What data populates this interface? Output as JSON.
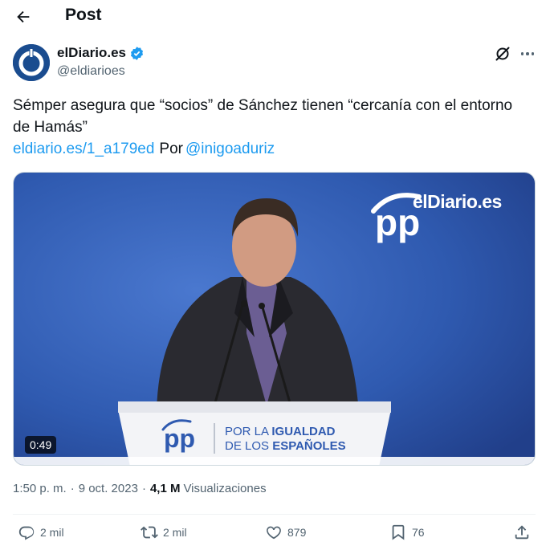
{
  "header": {
    "title": "Post"
  },
  "author": {
    "name": "elDiario.es",
    "handle": "@eldiarioes",
    "verified": true
  },
  "tweet": {
    "text": "Sémper asegura que “socios” de Sánchez tienen “cercanía con el entorno de Hamás”",
    "link": "eldiario.es/1_a179ed",
    "by_label": "Por",
    "mention": "@inigoaduriz"
  },
  "media": {
    "watermark": "elDiario.es",
    "duration": "0:49",
    "podium_line1_a": "POR LA ",
    "podium_line1_b": "IGUALDAD",
    "podium_line2_a": "DE LOS ",
    "podium_line2_b": "ESPAÑOLES",
    "party_logo": "pp"
  },
  "meta": {
    "time": "1:50 p. m.",
    "date": "9 oct. 2023",
    "views_count": "4,1 M",
    "views_label": "Visualizaciones"
  },
  "actions": {
    "replies": "2 mil",
    "reposts": "2 mil",
    "likes": "879",
    "bookmarks": "76"
  },
  "colors": {
    "link": "#1d9bf0",
    "verified": "#1d9bf0",
    "secondary_text": "#536471",
    "avatar_bg": "#1a4c8f",
    "video_bg": "#2f5ab0"
  },
  "icons": [
    "back-arrow-icon",
    "verified-badge-icon",
    "grok-icon",
    "more-icon",
    "reply-icon",
    "repost-icon",
    "like-icon",
    "bookmark-icon",
    "share-icon"
  ]
}
